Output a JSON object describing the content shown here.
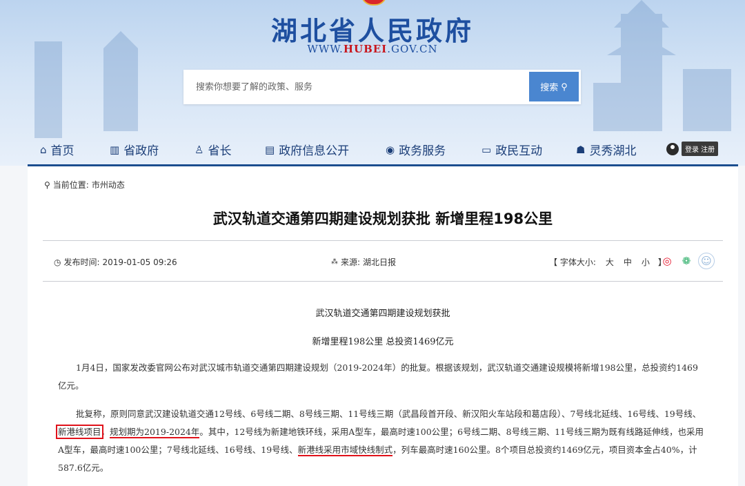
{
  "header": {
    "title": "湖北省人民政府",
    "url_prefix": "WWW.",
    "url_highlight": "HUBEI",
    "url_suffix": ".GOV.CN",
    "search_placeholder": "搜索你想要了解的政策、服务",
    "search_button": "搜索"
  },
  "nav": {
    "items": [
      {
        "label": "首页",
        "icon": "home-icon"
      },
      {
        "label": "省政府",
        "icon": "building-icon"
      },
      {
        "label": "省长",
        "icon": "person-icon"
      },
      {
        "label": "政府信息公开",
        "icon": "document-icon"
      },
      {
        "label": "政务服务",
        "icon": "service-icon"
      },
      {
        "label": "政民互动",
        "icon": "chat-icon"
      },
      {
        "label": "灵秀湖北",
        "icon": "hubei-map-icon"
      }
    ],
    "login_label": "登录 注册"
  },
  "breadcrumb": {
    "prefix": "当前位置:",
    "current": "市州动态"
  },
  "article": {
    "headline": "武汉轨道交通第四期建设规划获批 新增里程198公里",
    "publish_label": "发布时间:",
    "publish_time": "2019-01-05 09:26",
    "source_label": "来源:",
    "source": "湖北日报",
    "font_size_label": "【 字体大小:",
    "font_sizes": [
      "大",
      "中",
      "小"
    ],
    "font_size_close": "】",
    "subtitle1": "武汉轨道交通第四期建设规划获批",
    "subtitle2": "新增里程198公里 总投资1469亿元",
    "para1": "1月4日，国家发改委官网公布对武汉城市轨道交通第四期建设规划（2019-2024年）的批复。根据该规划，武汉轨道交通建设规模将新增198公里，总投资约1469亿元。",
    "para2_a": "批复称，原则同意武汉建设轨道交通12号线、6号线二期、8号线三期、11号线三期（武昌段首开段、新汉阳火车站段和葛店段）、7号线北延线、16号线、19号线、",
    "para2_box": "新港线项目",
    "para2_b": "，",
    "para2_u1": "规划期为2019-2024年",
    "para2_c": "。其中，12号线为新建地铁环线，采用A型车，最高时速100公里；6号线二期、8号线三期、11号线三期为既有线路延伸线，也采用A型车，最高时速100公里；7号线北延线、16号线、19号线、",
    "para2_u2": "新港线采用市域快线制式",
    "para2_d": "，列车最高时速160公里。8个项目总投资约1469亿元，项目资本金占40%，计587.6亿元。"
  }
}
